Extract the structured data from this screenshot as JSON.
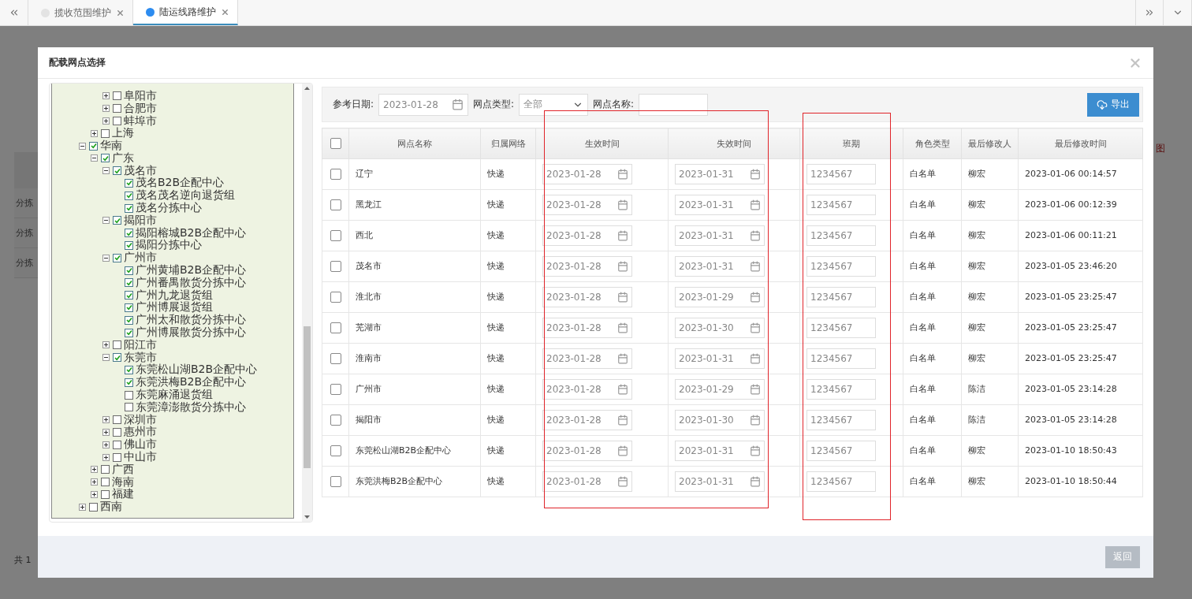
{
  "tabs": [
    {
      "label": "揽收范围维护",
      "selected": false
    },
    {
      "label": "陆运线路维护",
      "selected": true
    }
  ],
  "background": {
    "table_cells": [
      "分拣",
      "分拣",
      "分拣"
    ],
    "pager": "共 1",
    "side_mark": "图"
  },
  "dialog": {
    "title": "配载网点选择",
    "tree": [
      {
        "children": [
          {
            "children": [
              {
                "label": "阜阳市",
                "checked": false,
                "expanded": false
              },
              {
                "label": "合肥市",
                "checked": false,
                "expanded": false
              },
              {
                "label": "蚌埠市",
                "checked": false,
                "expanded": false
              }
            ]
          },
          {
            "label": "上海",
            "checked": false,
            "expanded": false
          }
        ]
      },
      {
        "label": "华南",
        "checked": true,
        "expanded": true,
        "children": [
          {
            "label": "广东",
            "checked": true,
            "expanded": true,
            "children": [
              {
                "label": "茂名市",
                "checked": true,
                "expanded": true,
                "children": [
                  {
                    "label": "茂名B2B企配中心",
                    "checked": true
                  },
                  {
                    "label": "茂名茂名逆向退货组",
                    "checked": true
                  },
                  {
                    "label": "茂名分拣中心",
                    "checked": true
                  }
                ]
              },
              {
                "label": "揭阳市",
                "checked": true,
                "expanded": true,
                "children": [
                  {
                    "label": "揭阳榕城B2B企配中心",
                    "checked": true
                  },
                  {
                    "label": "揭阳分拣中心",
                    "checked": true
                  }
                ]
              },
              {
                "label": "广州市",
                "checked": true,
                "expanded": true,
                "children": [
                  {
                    "label": "广州黄埔B2B企配中心",
                    "checked": true
                  },
                  {
                    "label": "广州番禺散货分拣中心",
                    "checked": true
                  },
                  {
                    "label": "广州九龙退货组",
                    "checked": true
                  },
                  {
                    "label": "广州博展退货组",
                    "checked": true
                  },
                  {
                    "label": "广州太和散货分拣中心",
                    "checked": true
                  },
                  {
                    "label": "广州博展散货分拣中心",
                    "checked": true
                  }
                ]
              },
              {
                "label": "阳江市",
                "checked": false,
                "expanded": false
              },
              {
                "label": "东莞市",
                "checked": true,
                "expanded": true,
                "children": [
                  {
                    "label": "东莞松山湖B2B企配中心",
                    "checked": true
                  },
                  {
                    "label": "东莞洪梅B2B企配中心",
                    "checked": true
                  },
                  {
                    "label": "东莞麻涌退货组",
                    "checked": false
                  },
                  {
                    "label": "东莞漳澎散货分拣中心",
                    "checked": false
                  }
                ]
              },
              {
                "label": "深圳市",
                "checked": false,
                "expanded": false
              },
              {
                "label": "惠州市",
                "checked": false,
                "expanded": false
              },
              {
                "label": "佛山市",
                "checked": false,
                "expanded": false
              },
              {
                "label": "中山市",
                "checked": false,
                "expanded": false
              }
            ]
          },
          {
            "label": "广西",
            "checked": false,
            "expanded": false
          },
          {
            "label": "海南",
            "checked": false,
            "expanded": false
          },
          {
            "label": "福建",
            "checked": false,
            "expanded": false
          }
        ]
      },
      {
        "label": "西南",
        "checked": false,
        "expanded": false
      }
    ],
    "filters": {
      "date_label": "参考日期:",
      "date_value": "2023-01-28",
      "type_label": "网点类型:",
      "type_value": "全部",
      "name_label": "网点名称:"
    },
    "export_button": "导出",
    "table": {
      "select_all": {
        "checked": false
      },
      "columns": [
        "网点名称",
        "归属网络",
        "生效时间",
        "失效时间",
        "班期",
        "角色类型",
        "最后修改人",
        "最后修改时间"
      ],
      "rows": [
        {
          "checked": false,
          "cells": [
            "辽宁",
            "快递",
            "2023-01-28",
            "2023-01-31",
            "1234567",
            "白名单",
            "柳宏",
            "2023-01-06 00:14:57"
          ]
        },
        {
          "checked": false,
          "cells": [
            "黑龙江",
            "快递",
            "2023-01-28",
            "2023-01-31",
            "1234567",
            "白名单",
            "柳宏",
            "2023-01-06 00:12:39"
          ]
        },
        {
          "checked": false,
          "cells": [
            "西北",
            "快递",
            "2023-01-28",
            "2023-01-31",
            "1234567",
            "白名单",
            "柳宏",
            "2023-01-06 00:11:21"
          ]
        },
        {
          "checked": false,
          "cells": [
            "茂名市",
            "快递",
            "2023-01-28",
            "2023-01-31",
            "1234567",
            "白名单",
            "柳宏",
            "2023-01-05 23:46:20"
          ]
        },
        {
          "checked": false,
          "cells": [
            "淮北市",
            "快递",
            "2023-01-28",
            "2023-01-29",
            "1234567",
            "白名单",
            "柳宏",
            "2023-01-05 23:25:47"
          ]
        },
        {
          "checked": false,
          "cells": [
            "芜湖市",
            "快递",
            "2023-01-28",
            "2023-01-30",
            "1234567",
            "白名单",
            "柳宏",
            "2023-01-05 23:25:47"
          ]
        },
        {
          "checked": false,
          "cells": [
            "淮南市",
            "快递",
            "2023-01-28",
            "2023-01-31",
            "1234567",
            "白名单",
            "柳宏",
            "2023-01-05 23:25:47"
          ]
        },
        {
          "checked": false,
          "cells": [
            "广州市",
            "快递",
            "2023-01-28",
            "2023-01-29",
            "1234567",
            "白名单",
            "陈洁",
            "2023-01-05 23:14:28"
          ]
        },
        {
          "checked": false,
          "cells": [
            "揭阳市",
            "快递",
            "2023-01-28",
            "2023-01-30",
            "1234567",
            "白名单",
            "陈洁",
            "2023-01-05 23:14:28"
          ]
        },
        {
          "checked": false,
          "cells": [
            "东莞松山湖B2B企配中心",
            "快递",
            "2023-01-28",
            "2023-01-31",
            "1234567",
            "白名单",
            "柳宏",
            "2023-01-10 18:50:43"
          ]
        },
        {
          "checked": false,
          "cells": [
            "东莞洪梅B2B企配中心",
            "快递",
            "2023-01-28",
            "2023-01-31",
            "1234567",
            "白名单",
            "柳宏",
            "2023-01-10 18:50:44"
          ]
        }
      ]
    },
    "back_button": "返回"
  },
  "annotations": [
    {
      "kind": "frame"
    },
    {
      "kind": "frame"
    }
  ]
}
